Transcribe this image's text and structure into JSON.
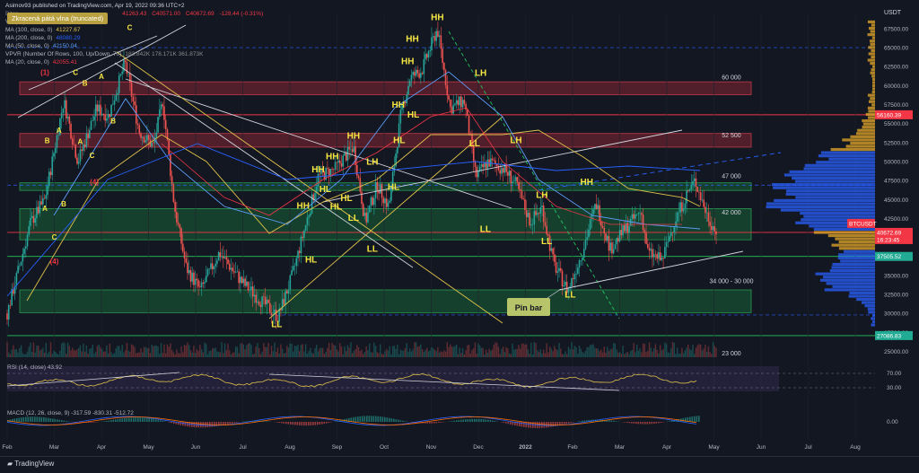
{
  "header": {
    "publish_line": "Asimov93 published on TradingView.com, Apr 19, 2022 09:36 UTC+2",
    "ohlc": [
      "41263.43",
      "C40571.00",
      "C40672.69",
      "-128.44 (-0.31%)"
    ],
    "symbol_prefix": "Bitco",
    "indicators": [
      {
        "label": "Vol (20)",
        "value": "38.374K"
      },
      {
        "label": "MA (100, close, 0)",
        "value": "41227.67"
      },
      {
        "label": "MA (200, close, 0)",
        "value": "48080.29"
      },
      {
        "label": "MA (50, close, 0)",
        "value": "42150.04"
      },
      {
        "label": "VPVR (Number Of Rows, 100, Up/Down, 70)",
        "value": "183.842K 178.171K 361.873K"
      },
      {
        "label": "MA (20, close, 0)",
        "value": "42055.41"
      }
    ],
    "callout_label": "Zkracená pátá vlna (truncated)",
    "currency": "USDT"
  },
  "chart_data": {
    "type": "candlestick",
    "x_months": [
      "Feb",
      "Mar",
      "Apr",
      "May",
      "Jun",
      "Jul",
      "Aug",
      "Sep",
      "Oct",
      "Nov",
      "Dec",
      "2022",
      "Feb",
      "Mar",
      "Apr",
      "May",
      "Jun",
      "Jul",
      "Aug"
    ],
    "price_axis": [
      "67500.00",
      "65000.00",
      "62500.00",
      "60000.00",
      "57500.00",
      "55000.00",
      "52500.00",
      "50000.00",
      "47500.00",
      "45000.00",
      "42500.00",
      "40000.00",
      "37500.00",
      "35000.00",
      "32500.00",
      "30000.00",
      "27500.00",
      "25000.00"
    ],
    "ylim": [
      24000,
      69500
    ],
    "price_tags": [
      {
        "label": "56160.39",
        "price": 56160.39,
        "color": "#f23645"
      },
      {
        "label": "40672.69",
        "price": 40672.69,
        "color": "#f23645"
      },
      {
        "label": "BTCUSDT",
        "price": 40672.69,
        "color": "#f23645"
      },
      {
        "label": "16:23:45",
        "price": 40672.69,
        "color": "#f23645"
      },
      {
        "label": "37505.52",
        "price": 37505.52,
        "color": "#22ab94"
      },
      {
        "label": "27086.83",
        "price": 27086.83,
        "color": "#22ab94"
      }
    ],
    "zone_labels": [
      {
        "text": "60 000",
        "price": 60800
      },
      {
        "text": "52 500",
        "price": 53200
      },
      {
        "text": "47 000",
        "price": 47800
      },
      {
        "text": "42 000",
        "price": 43000
      },
      {
        "text": "34 000 - 30 000",
        "price": 34000
      },
      {
        "text": "23 000",
        "price": 24500
      }
    ],
    "zones": [
      {
        "from": 58800,
        "to": 60500,
        "color": "red"
      },
      {
        "from": 51900,
        "to": 53700,
        "color": "red"
      },
      {
        "from": 46200,
        "to": 47200,
        "color": "green"
      },
      {
        "from": 39700,
        "to": 43800,
        "color": "green"
      },
      {
        "from": 30100,
        "to": 33100,
        "color": "green"
      }
    ],
    "h_lines": [
      {
        "price": 56160,
        "color": "red"
      },
      {
        "price": 40672,
        "color": "red"
      },
      {
        "price": 37505,
        "color": "green"
      },
      {
        "price": 27086,
        "color": "green"
      }
    ],
    "wave_labels": [
      {
        "text": "HH",
        "month": 9.13,
        "price": 68600,
        "color": "yellow"
      },
      {
        "text": "HH",
        "month": 8.6,
        "price": 65800,
        "color": "yellow"
      },
      {
        "text": "HH",
        "month": 8.5,
        "price": 62800,
        "color": "yellow"
      },
      {
        "text": "HH",
        "month": 8.3,
        "price": 57100,
        "color": "yellow"
      },
      {
        "text": "HL",
        "month": 8.62,
        "price": 55800,
        "color": "yellow"
      },
      {
        "text": "HL",
        "month": 8.32,
        "price": 52400,
        "color": "yellow"
      },
      {
        "text": "HH",
        "month": 7.35,
        "price": 53000,
        "color": "yellow"
      },
      {
        "text": "HH",
        "month": 6.9,
        "price": 50300,
        "color": "yellow"
      },
      {
        "text": "HH",
        "month": 6.6,
        "price": 48600,
        "color": "yellow"
      },
      {
        "text": "HH",
        "month": 6.28,
        "price": 43800,
        "color": "yellow"
      },
      {
        "text": "HL",
        "month": 6.75,
        "price": 46000,
        "color": "yellow"
      },
      {
        "text": "HL",
        "month": 6.98,
        "price": 43700,
        "color": "yellow"
      },
      {
        "text": "HL",
        "month": 7.2,
        "price": 44800,
        "color": "yellow"
      },
      {
        "text": "HL",
        "month": 6.45,
        "price": 36700,
        "color": "yellow"
      },
      {
        "text": "HL",
        "month": 8.2,
        "price": 46300,
        "color": "yellow"
      },
      {
        "text": "LH",
        "month": 7.75,
        "price": 49600,
        "color": "yellow"
      },
      {
        "text": "LL",
        "month": 7.35,
        "price": 42200,
        "color": "yellow"
      },
      {
        "text": "LL",
        "month": 7.75,
        "price": 38100,
        "color": "yellow"
      },
      {
        "text": "LH",
        "month": 10.05,
        "price": 61300,
        "color": "yellow"
      },
      {
        "text": "LL",
        "month": 9.92,
        "price": 52000,
        "color": "yellow"
      },
      {
        "text": "LH",
        "month": 10.8,
        "price": 52400,
        "color": "yellow"
      },
      {
        "text": "LL",
        "month": 10.15,
        "price": 40700,
        "color": "yellow"
      },
      {
        "text": "LH",
        "month": 11.35,
        "price": 45200,
        "color": "yellow"
      },
      {
        "text": "LL",
        "month": 11.45,
        "price": 39100,
        "color": "yellow"
      },
      {
        "text": "HH",
        "month": 12.3,
        "price": 46900,
        "color": "yellow"
      },
      {
        "text": "LL",
        "month": 11.95,
        "price": 32100,
        "color": "yellow"
      },
      {
        "text": "LL",
        "month": 5.72,
        "price": 28200,
        "color": "yellow"
      },
      {
        "text": "C",
        "month": 2.6,
        "price": 67300,
        "color": "yellow"
      },
      {
        "text": "C",
        "month": 1.45,
        "price": 61400,
        "color": "yellow"
      },
      {
        "text": "B",
        "month": 1.65,
        "price": 60000,
        "color": "yellow"
      },
      {
        "text": "A",
        "month": 2.0,
        "price": 60900,
        "color": "yellow"
      },
      {
        "text": "B",
        "month": 2.25,
        "price": 55000,
        "color": "yellow"
      },
      {
        "text": "A",
        "month": 1.1,
        "price": 53800,
        "color": "yellow"
      },
      {
        "text": "B",
        "month": 0.85,
        "price": 52400,
        "color": "yellow"
      },
      {
        "text": "A",
        "month": 1.55,
        "price": 52300,
        "color": "yellow"
      },
      {
        "text": "C",
        "month": 1.8,
        "price": 50500,
        "color": "yellow"
      },
      {
        "text": "A",
        "month": 0.8,
        "price": 43500,
        "color": "yellow"
      },
      {
        "text": "B",
        "month": 1.2,
        "price": 44100,
        "color": "yellow"
      },
      {
        "text": "C",
        "month": 1.0,
        "price": 39700,
        "color": "yellow"
      },
      {
        "text": "(1)",
        "month": 0.8,
        "price": 61400,
        "color": "red"
      },
      {
        "text": "(4)",
        "month": 1.85,
        "price": 47000,
        "color": "red"
      },
      {
        "text": "(4)",
        "month": 1.0,
        "price": 36500,
        "color": "red"
      }
    ],
    "pin_bar_label": "Pin bar",
    "rsi": {
      "label": "RSI (14, close)",
      "value": "43.92",
      "levels": [
        "70.00",
        "30.00"
      ]
    },
    "macd": {
      "label": "MACD (12, 26, close, 9)",
      "values": [
        "-317.59",
        "-830.31",
        "-512.72"
      ],
      "axis": "0.00"
    }
  },
  "footer": {
    "brand": "TradingView"
  }
}
